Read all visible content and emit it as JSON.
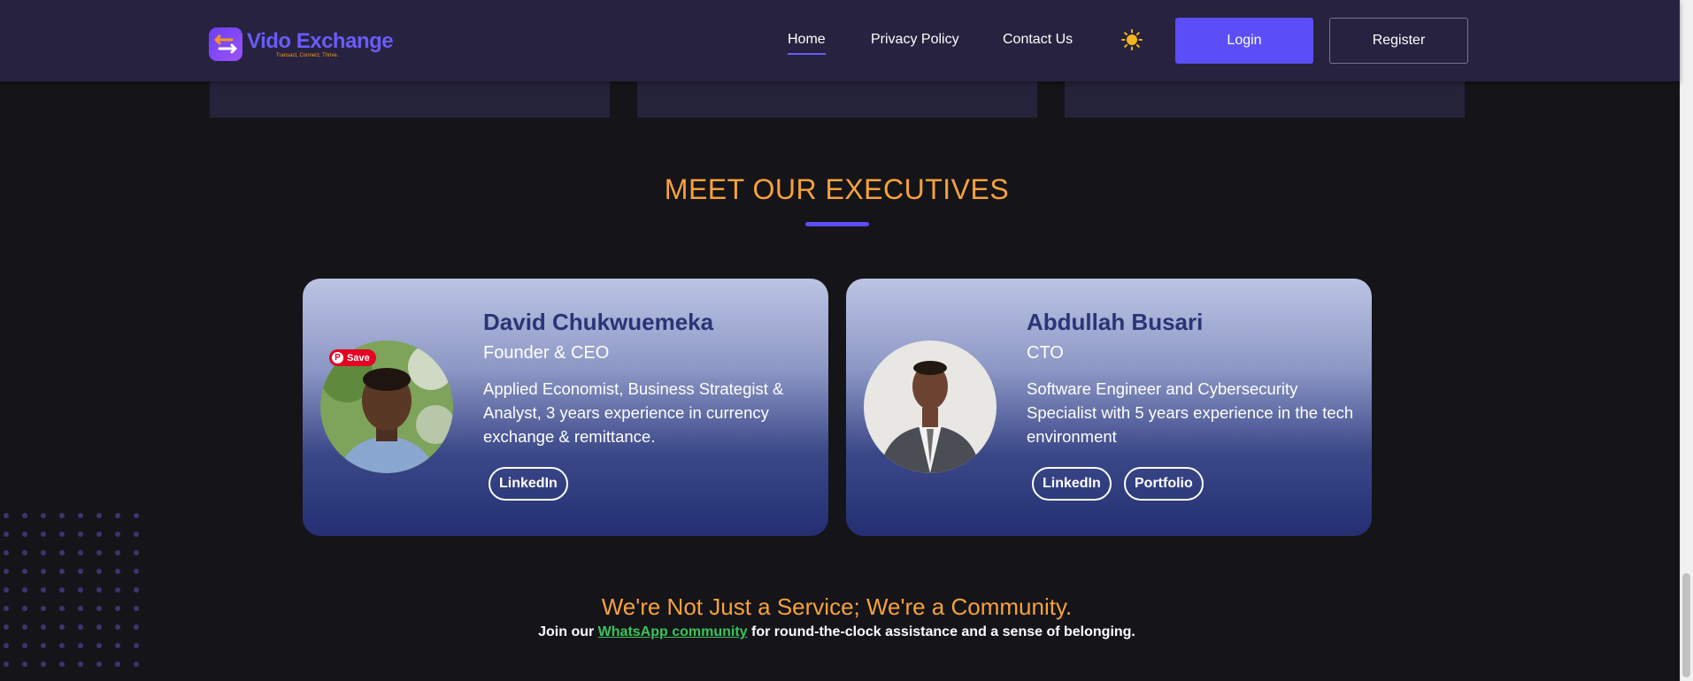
{
  "header": {
    "brand_name": "Vido Exchange",
    "brand_tagline": "Transact, Connect, Thrive.",
    "nav": [
      "Home",
      "Privacy Policy",
      "Contact Us"
    ],
    "active_nav": "Home",
    "theme_icon": "sun-icon",
    "login_label": "Login",
    "register_label": "Register"
  },
  "executives_section": {
    "title": "MEET OUR EXECUTIVES",
    "executives": [
      {
        "name": "David Chukwuemeka",
        "role": "Founder & CEO",
        "bio": "Applied Economist, Business Strategist & Analyst, 3 years experience in currency exchange & remittance.",
        "links": [
          "LinkedIn"
        ]
      },
      {
        "name": "Abdullah Busari",
        "role": "CTO",
        "bio": "Software Engineer and Cybersecurity Specialist with 5 years experience in the tech environment",
        "links": [
          "LinkedIn",
          "Portfolio"
        ]
      }
    ]
  },
  "pinterest_save_label": "Save",
  "community": {
    "title": "We're Not Just a Service; We're a Community.",
    "text_before": "Join our",
    "link_text": "WhatsApp community",
    "text_after": "for round-the-clock assistance and a sense of belonging."
  },
  "colors": {
    "accent": "#5b4ef6",
    "heading_orange": "#f6a23c",
    "link_green": "#3bc45a",
    "header_bg": "#27223f",
    "page_bg": "#151419"
  }
}
